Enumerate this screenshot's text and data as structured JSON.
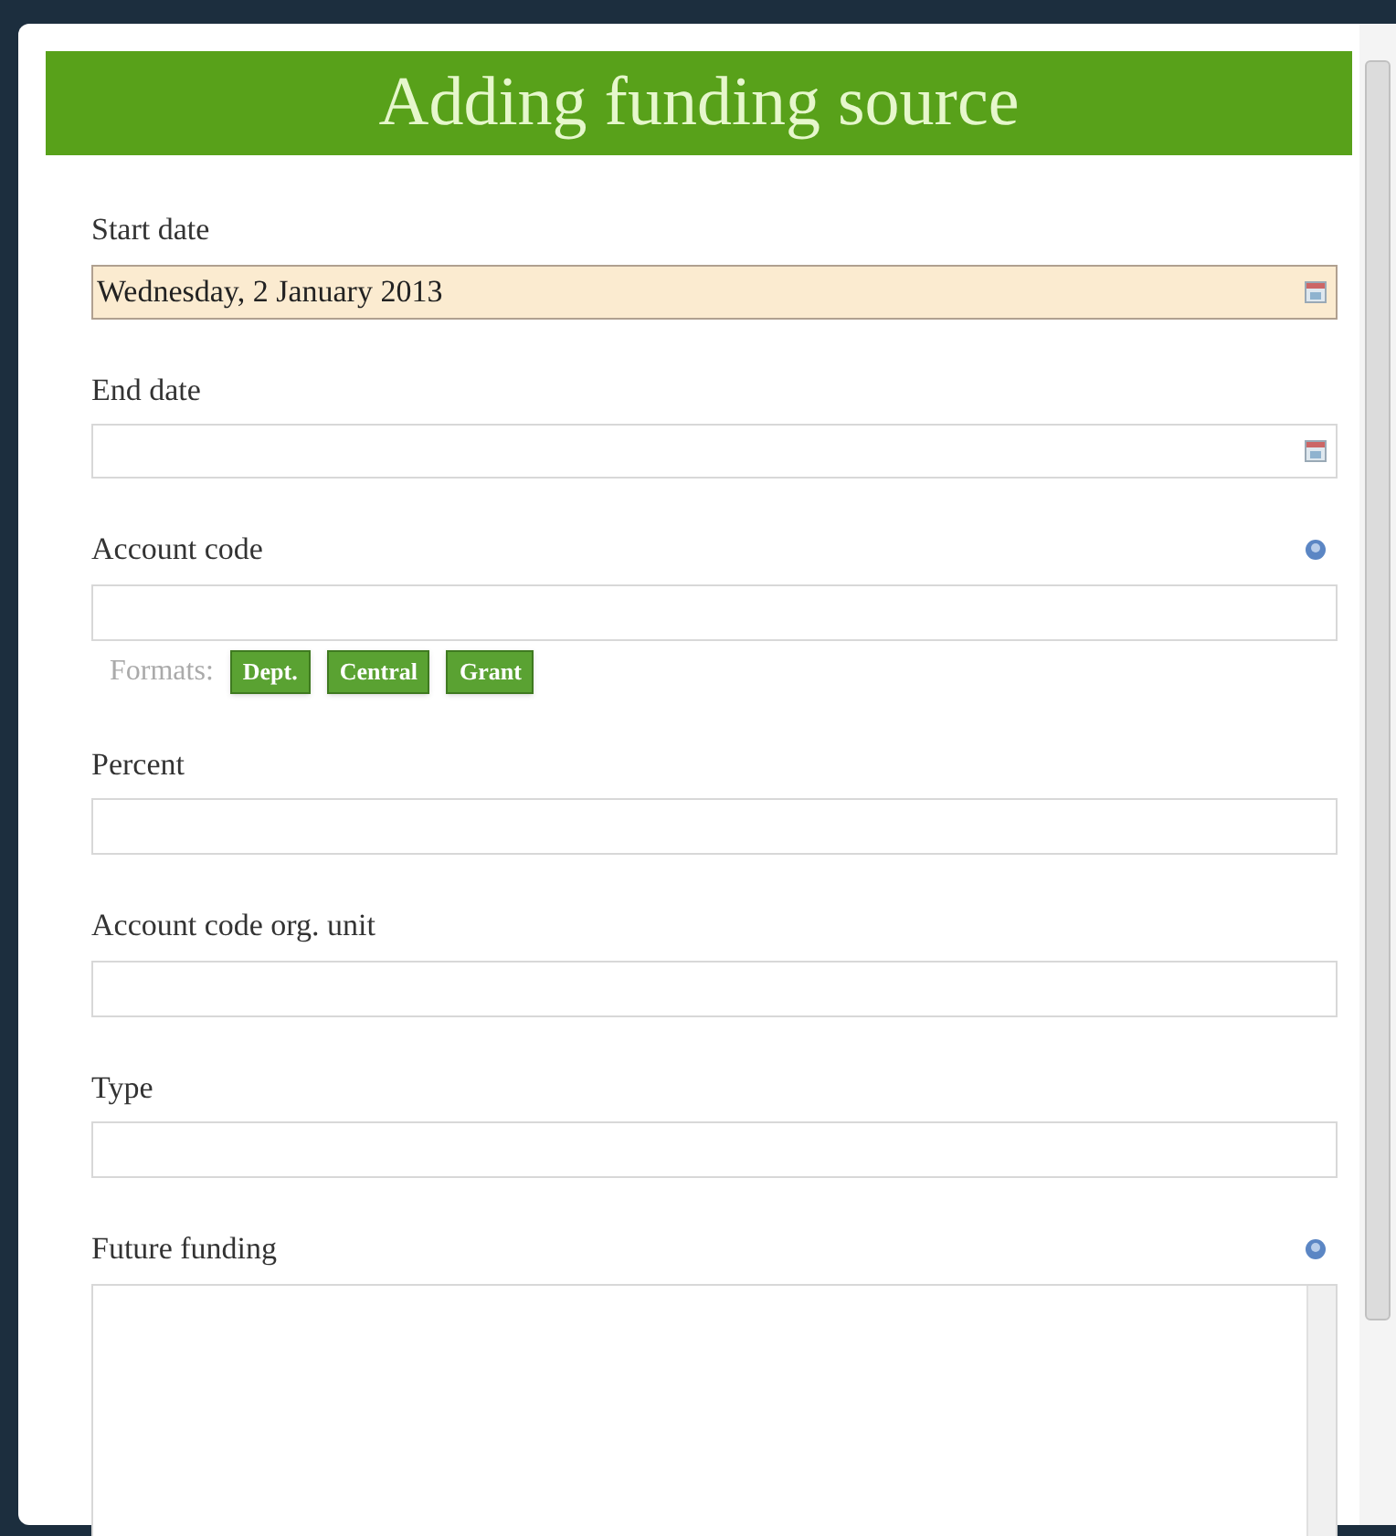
{
  "dialog": {
    "title": "Adding funding source",
    "fields": [
      {
        "kind": "date",
        "label": "Start date",
        "value": "Wednesday, 2 January 2013",
        "focused": true,
        "help": false
      },
      {
        "kind": "date",
        "label": "End date",
        "focused": false,
        "help": false
      },
      {
        "kind": "text",
        "label": "Account code",
        "focused": false,
        "help": true,
        "formats_label": "Formats:",
        "formats": [
          "Dept.",
          "Central",
          "Grant"
        ]
      },
      {
        "kind": "text",
        "label": "Percent",
        "focused": false,
        "help": false
      },
      {
        "kind": "text",
        "label": "Account code org. unit",
        "focused": false,
        "help": false
      },
      {
        "kind": "text",
        "label": "Type",
        "focused": false,
        "help": false
      },
      {
        "kind": "textarea",
        "label": "Future funding",
        "focused": false,
        "help": true
      }
    ]
  }
}
